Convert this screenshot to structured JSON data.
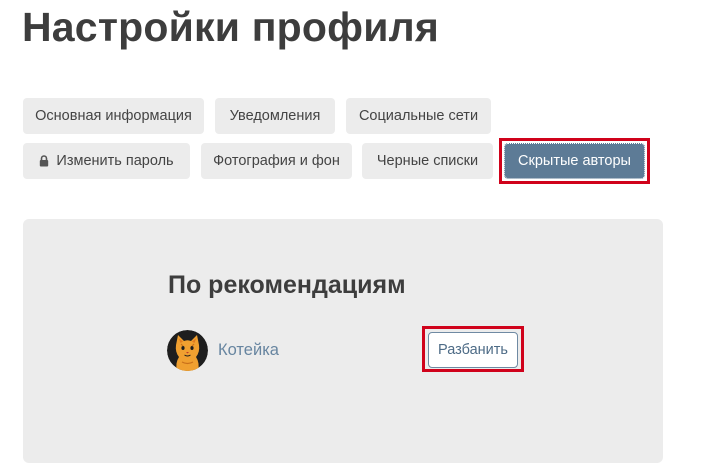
{
  "page": {
    "title": "Настройки профиля"
  },
  "tabs": {
    "basic_info": "Основная информация",
    "notifications": "Уведомления",
    "social_networks": "Социальные сети",
    "change_password": "Изменить пароль",
    "photo_background": "Фотография и фон",
    "blacklists": "Черные списки",
    "hidden_authors": "Скрытые авторы",
    "active": "hidden_authors"
  },
  "section": {
    "title": "По рекомендациям",
    "authors": [
      {
        "name": "Котейка",
        "avatar_icon": "cat-avatar",
        "action_label": "Разбанить"
      }
    ]
  },
  "colors": {
    "accent": "#5d7b96",
    "highlight": "#d0021b",
    "link": "#6785a0",
    "tab_bg": "#ececec",
    "panel_bg": "#ececec"
  }
}
